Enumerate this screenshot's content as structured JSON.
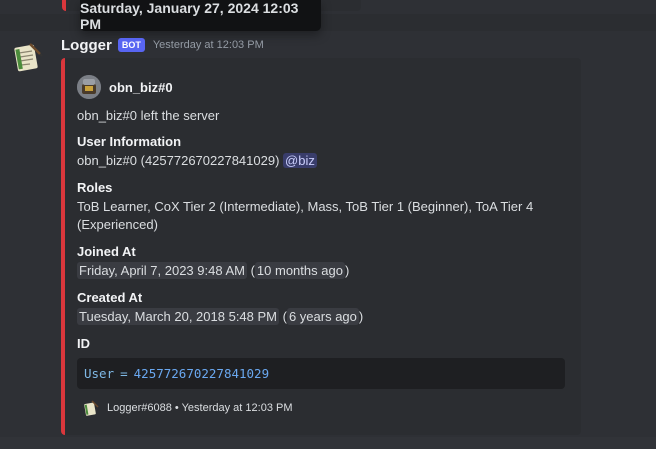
{
  "tooltip": {
    "text": "Saturday, January 27, 2024 12:03 PM"
  },
  "message": {
    "author": "Logger",
    "bot_tag": "BOT",
    "timestamp": "Yesterday at 12:03 PM",
    "avatar_icon": "notepad-pencil-icon"
  },
  "embed": {
    "accent_color": "#da373c",
    "author_name": "obn_biz#0",
    "description": "obn_biz#0 left the server",
    "fields": {
      "user_info": {
        "name": "User Information",
        "value_text": "obn_biz#0 (425772670227841029)",
        "mention": "@biz"
      },
      "roles": {
        "name": "Roles",
        "line1": "ToB Learner, CoX Tier 2 (Intermediate), Mass, ToB Tier 1 (Beginner), ToA Tier 4",
        "line2": "(Experienced)"
      },
      "joined": {
        "name": "Joined At",
        "date": "Friday, April 7, 2023 9:48 AM",
        "relative": "10 months ago"
      },
      "created": {
        "name": "Created At",
        "date": "Tuesday, March 20, 2018 5:48 PM",
        "relative": "6 years ago"
      },
      "id": {
        "name": "ID",
        "code_key": "User",
        "code_op": "=",
        "code_value": "425772670227841029"
      }
    },
    "footer": {
      "text": "Logger#6088 • Yesterday at 12:03 PM",
      "icon": "notepad-pencil-icon"
    }
  }
}
